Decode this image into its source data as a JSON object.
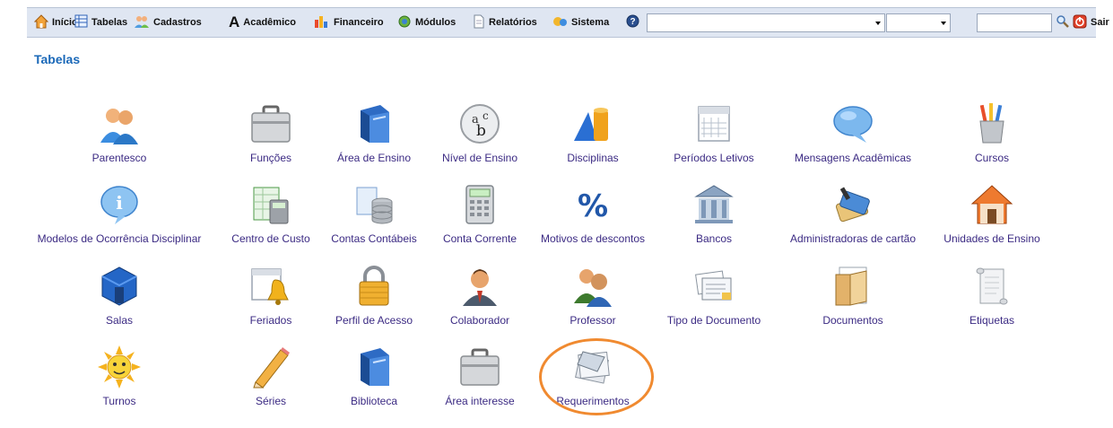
{
  "menu": {
    "inicio": "Início",
    "tabelas": "Tabelas",
    "cadastros": "Cadastros",
    "academico": "Acadêmico",
    "financeiro": "Financeiro",
    "modulos": "Módulos",
    "relatorios": "Relatórios",
    "sistema": "Sistema",
    "sair": "Sair"
  },
  "page": {
    "title": "Tabelas"
  },
  "items": [
    {
      "label": "Parentesco",
      "icon": "people-icon"
    },
    {
      "label": "Funções",
      "icon": "briefcase-icon"
    },
    {
      "label": "Área de Ensino",
      "icon": "book-icon"
    },
    {
      "label": "Nível de Ensino",
      "icon": "abc-icon"
    },
    {
      "label": "Disciplinas",
      "icon": "shapes-icon"
    },
    {
      "label": "Períodos Letivos",
      "icon": "calendar-icon"
    },
    {
      "label": "Mensagens Acadêmicas",
      "icon": "speech-bubble-icon"
    },
    {
      "label": "Cursos",
      "icon": "pencil-cup-icon"
    },
    {
      "label": "Modelos de Ocorrência Disciplinar",
      "icon": "info-bubble-icon"
    },
    {
      "label": "Centro de Custo",
      "icon": "spreadsheet-calculator-icon"
    },
    {
      "label": "Contas Contábeis",
      "icon": "database-icon"
    },
    {
      "label": "Conta Corrente",
      "icon": "calculator-icon"
    },
    {
      "label": "Motivos de descontos",
      "icon": "percent-icon"
    },
    {
      "label": "Bancos",
      "icon": "bank-icon"
    },
    {
      "label": "Administradoras de cartão",
      "icon": "cards-icon"
    },
    {
      "label": "Unidades de Ensino",
      "icon": "house-icon"
    },
    {
      "label": "Salas",
      "icon": "room-icon"
    },
    {
      "label": "Feriados",
      "icon": "calendar-bell-icon"
    },
    {
      "label": "Perfil de Acesso",
      "icon": "padlock-icon"
    },
    {
      "label": "Colaborador",
      "icon": "person-icon"
    },
    {
      "label": "Professor",
      "icon": "teacher-icon"
    },
    {
      "label": "Tipo de Documento",
      "icon": "document-types-icon"
    },
    {
      "label": "Documentos",
      "icon": "folder-docs-icon"
    },
    {
      "label": "Etiquetas",
      "icon": "scroll-icon"
    },
    {
      "label": "Turnos",
      "icon": "sun-icon"
    },
    {
      "label": "Séries",
      "icon": "pencil-icon"
    },
    {
      "label": "Biblioteca",
      "icon": "book-icon"
    },
    {
      "label": "Área interesse",
      "icon": "briefcase-icon"
    },
    {
      "label": "Requerimentos",
      "icon": "papers-icon"
    }
  ],
  "colors": {
    "link": "#3b2a83",
    "title": "#1a68b8",
    "highlight": "#f08a30"
  }
}
